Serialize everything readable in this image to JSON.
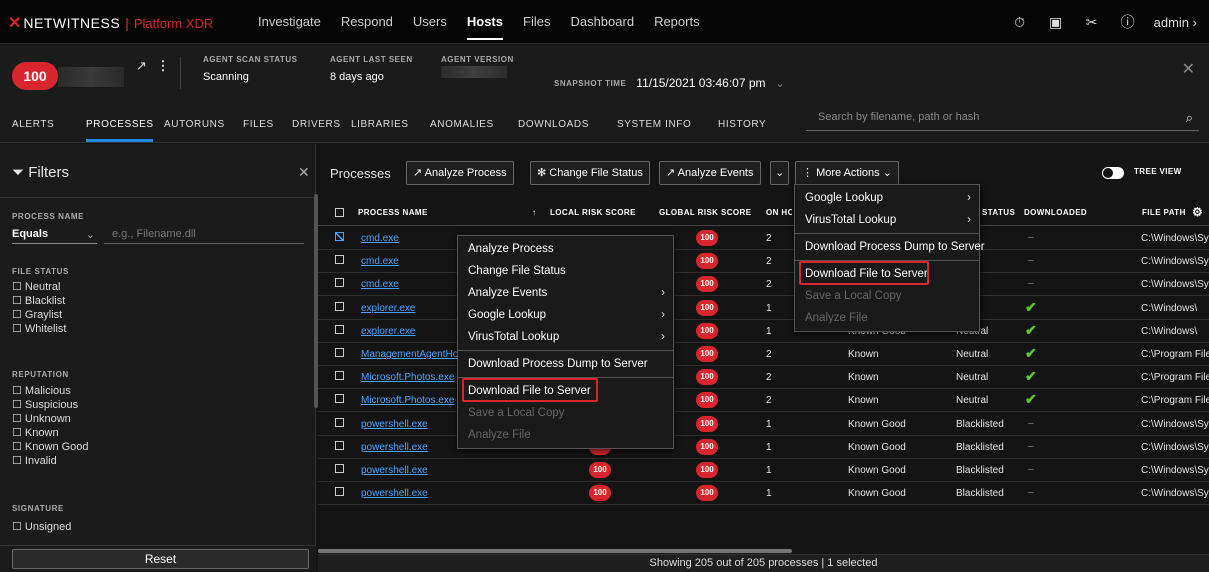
{
  "header": {
    "brand": "NETWITNESS",
    "platform": "Platform XDR",
    "nav": [
      "Investigate",
      "Respond",
      "Users",
      "Hosts",
      "Files",
      "Dashboard",
      "Reports"
    ],
    "active_nav": "Hosts",
    "user": "admin"
  },
  "host": {
    "risk_score": "100",
    "scan_status_label": "AGENT SCAN STATUS",
    "scan_status": "Scanning",
    "last_seen_label": "AGENT LAST SEEN",
    "last_seen": "8 days ago",
    "version_label": "AGENT VERSION",
    "snapshot_label": "SNAPSHOT TIME",
    "snapshot_value": "11/15/2021 03:46:07 pm"
  },
  "tabs": [
    "ALERTS",
    "PROCESSES",
    "AUTORUNS",
    "FILES",
    "DRIVERS",
    "LIBRARIES",
    "ANOMALIES",
    "DOWNLOADS",
    "SYSTEM INFO",
    "HISTORY"
  ],
  "active_tab": "PROCESSES",
  "search": {
    "placeholder": "Search by filename, path or hash"
  },
  "filters": {
    "title": "Filters",
    "process_name_label": "PROCESS NAME",
    "operator": "Equals",
    "name_placeholder": "e.g., Filename.dll",
    "file_status_label": "FILE STATUS",
    "file_status": [
      "Neutral",
      "Blacklist",
      "Graylist",
      "Whitelist"
    ],
    "reputation_label": "REPUTATION",
    "reputation": [
      "Malicious",
      "Suspicious",
      "Unknown",
      "Known",
      "Known Good",
      "Invalid"
    ],
    "signature_label": "SIGNATURE",
    "signature": [
      "Unsigned"
    ],
    "reset": "Reset"
  },
  "toolbar": {
    "title": "Processes",
    "analyze_process": "Analyze Process",
    "change_file_status": "Change File Status",
    "analyze_events": "Analyze Events",
    "more_actions": "More Actions",
    "tree_view": "TREE VIEW"
  },
  "columns": [
    "PROCESS NAME",
    "LOCAL RISK SCORE",
    "GLOBAL RISK SCORE",
    "ON HO",
    "STATUS",
    "DOWNLOADED",
    "FILE PATH"
  ],
  "rows": [
    {
      "name": "cmd.exe",
      "local": "",
      "global": "100",
      "hosts": "2",
      "rep": "",
      "status": "al",
      "dl": false,
      "path": "C:\\Windows\\Syst",
      "checked": true
    },
    {
      "name": "cmd.exe",
      "local": "",
      "global": "100",
      "hosts": "2",
      "rep": "",
      "status": "al",
      "dl": false,
      "path": "C:\\Windows\\Syst",
      "checked": false
    },
    {
      "name": "cmd.exe",
      "local": "",
      "global": "100",
      "hosts": "2",
      "rep": "",
      "status": "al",
      "dl": false,
      "path": "C:\\Windows\\Syst",
      "checked": false
    },
    {
      "name": "explorer.exe",
      "local": "",
      "global": "100",
      "hosts": "1",
      "rep": "",
      "status": "al",
      "dl": true,
      "path": "C:\\Windows\\",
      "checked": false
    },
    {
      "name": "explorer.exe",
      "local": "",
      "global": "100",
      "hosts": "1",
      "rep": "Known Good",
      "status": "Neutral",
      "dl": true,
      "path": "C:\\Windows\\",
      "checked": false
    },
    {
      "name": "ManagementAgentHost",
      "local": "",
      "global": "100",
      "hosts": "2",
      "rep": "Known",
      "status": "Neutral",
      "dl": true,
      "path": "C:\\Program Files\\",
      "checked": false
    },
    {
      "name": "Microsoft.Photos.exe",
      "local": "",
      "global": "100",
      "hosts": "2",
      "rep": "Known",
      "status": "Neutral",
      "dl": true,
      "path": "C:\\Program Files\\",
      "checked": false
    },
    {
      "name": "Microsoft.Photos.exe",
      "local": "",
      "global": "100",
      "hosts": "2",
      "rep": "Known",
      "status": "Neutral",
      "dl": true,
      "path": "C:\\Program Files\\",
      "checked": false
    },
    {
      "name": "powershell.exe",
      "local": "",
      "global": "100",
      "hosts": "1",
      "rep": "Known Good",
      "status": "Blacklisted",
      "dl": false,
      "path": "C:\\Windows\\Syst",
      "checked": false
    },
    {
      "name": "powershell.exe",
      "local": "100",
      "global": "100",
      "hosts": "1",
      "rep": "Known Good",
      "status": "Blacklisted",
      "dl": false,
      "path": "C:\\Windows\\Syst",
      "checked": false
    },
    {
      "name": "powershell.exe",
      "local": "100",
      "global": "100",
      "hosts": "1",
      "rep": "Known Good",
      "status": "Blacklisted",
      "dl": false,
      "path": "C:\\Windows\\Syst",
      "checked": false
    },
    {
      "name": "powershell.exe",
      "local": "100",
      "global": "100",
      "hosts": "1",
      "rep": "Known Good",
      "status": "Blacklisted",
      "dl": false,
      "path": "C:\\Windows\\Syst",
      "checked": false
    }
  ],
  "context_menu": {
    "items": [
      {
        "label": "Analyze Process",
        "sub": false,
        "disabled": false
      },
      {
        "label": "Change File Status",
        "sub": false,
        "disabled": false
      },
      {
        "label": "Analyze Events",
        "sub": true,
        "disabled": false
      },
      {
        "label": "Google Lookup",
        "sub": true,
        "disabled": false
      },
      {
        "label": "VirusTotal Lookup",
        "sub": true,
        "disabled": false
      },
      {
        "label": "Download Process Dump to Server",
        "sub": false,
        "disabled": false
      },
      {
        "label": "Download File to Server",
        "sub": false,
        "disabled": false
      },
      {
        "label": "Save a Local Copy",
        "sub": false,
        "disabled": true
      },
      {
        "label": "Analyze File",
        "sub": false,
        "disabled": true
      }
    ]
  },
  "more_menu": {
    "items": [
      {
        "label": "Google Lookup",
        "sub": true,
        "disabled": false
      },
      {
        "label": "VirusTotal Lookup",
        "sub": true,
        "disabled": false
      },
      {
        "label": "Download Process Dump to Server",
        "sub": false,
        "disabled": false
      },
      {
        "label": "Download File to Server",
        "sub": false,
        "disabled": false
      },
      {
        "label": "Save a Local Copy",
        "sub": false,
        "disabled": true
      },
      {
        "label": "Analyze File",
        "sub": false,
        "disabled": true
      }
    ]
  },
  "footer": "Showing 205 out of 205 processes | 1 selected",
  "colors": {
    "accent": "#1e88e5",
    "risk": "#d9262e",
    "ok": "#5ec82a",
    "highlight": "#d9262e"
  }
}
